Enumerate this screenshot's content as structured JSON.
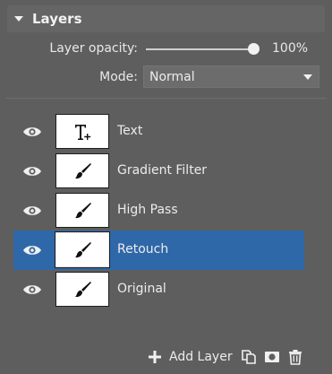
{
  "panel": {
    "title": "Layers"
  },
  "opacity": {
    "label": "Layer opacity:",
    "value_text": "100%",
    "value": 1.0
  },
  "mode": {
    "label": "Mode:",
    "selected": "Normal"
  },
  "layers": [
    {
      "name": "Text",
      "thumb_icon": "text-layer-icon",
      "visible": true,
      "selected": false
    },
    {
      "name": "Gradient Filter",
      "thumb_icon": "brush-icon",
      "visible": true,
      "selected": false
    },
    {
      "name": "High Pass",
      "thumb_icon": "brush-icon",
      "visible": true,
      "selected": false
    },
    {
      "name": "Retouch",
      "thumb_icon": "brush-icon",
      "visible": true,
      "selected": true
    },
    {
      "name": "Original",
      "thumb_icon": "brush-icon",
      "visible": true,
      "selected": false
    }
  ],
  "footer": {
    "add_layer_label": "Add Layer"
  },
  "colors": {
    "background": "#5e5e5e",
    "selection": "#2f68a8",
    "header": "#656565"
  }
}
